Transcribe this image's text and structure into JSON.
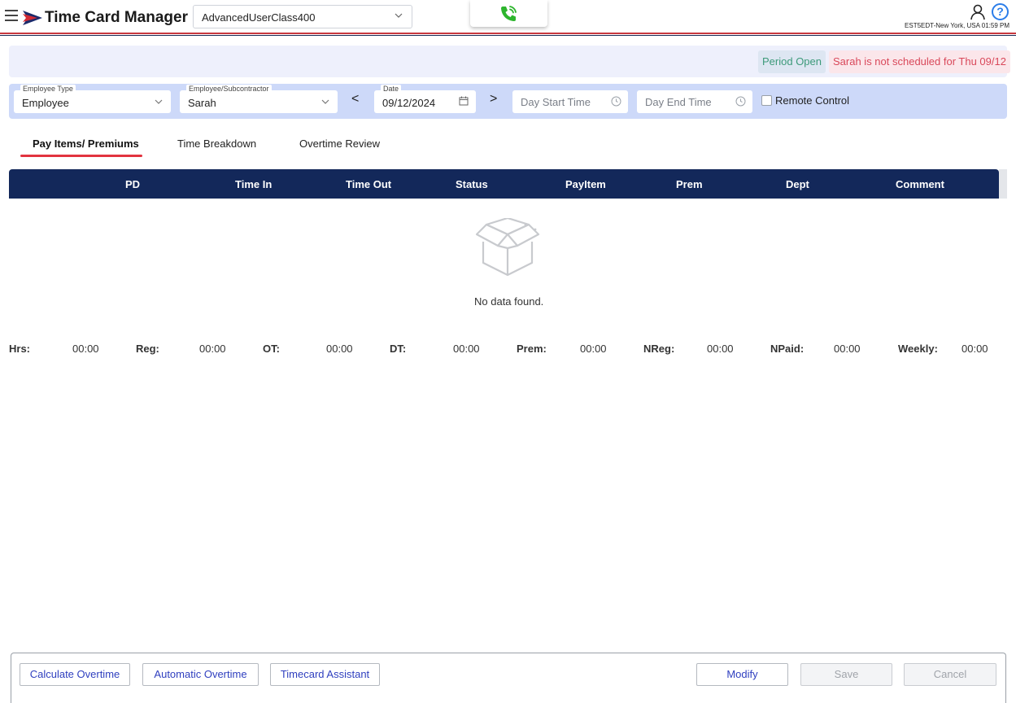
{
  "header": {
    "title": "Time Card Manager",
    "user_class": "AdvancedUserClass400",
    "timezone": "EST5EDT-New York, USA 01:59 PM",
    "help_glyph": "?"
  },
  "status": {
    "period": "Period Open",
    "schedule_notice": "Sarah is not scheduled for Thu 09/12"
  },
  "filters": {
    "employee_type_label": "Employee Type",
    "employee_type_value": "Employee",
    "employee_label": "Employee/Subcontractor",
    "employee_value": "Sarah",
    "date_label": "Date",
    "date_value": "09/12/2024",
    "prev_glyph": "<",
    "next_glyph": ">",
    "day_start_placeholder": "Day Start Time",
    "day_end_placeholder": "Day End Time",
    "remote_control_label": "Remote Control"
  },
  "tabs": [
    {
      "label": "Pay Items/ Premiums",
      "active": true
    },
    {
      "label": "Time Breakdown",
      "active": false
    },
    {
      "label": "Overtime Review",
      "active": false
    }
  ],
  "table": {
    "columns": [
      "PD",
      "Time In",
      "Time Out",
      "Status",
      "PayItem",
      "Prem",
      "Dept",
      "Comment"
    ],
    "empty_text": "No data found."
  },
  "totals": [
    {
      "label": "Hrs:",
      "value": "00:00"
    },
    {
      "label": "Reg:",
      "value": "00:00"
    },
    {
      "label": "OT:",
      "value": "00:00"
    },
    {
      "label": "DT:",
      "value": "00:00"
    },
    {
      "label": "Prem:",
      "value": "00:00"
    },
    {
      "label": "NReg:",
      "value": "00:00"
    },
    {
      "label": "NPaid:",
      "value": "00:00"
    },
    {
      "label": "Weekly:",
      "value": "00:00"
    }
  ],
  "footer": {
    "calculate_overtime": "Calculate Overtime",
    "automatic_overtime": "Automatic Overtime",
    "timecard_assistant": "Timecard Assistant",
    "modify": "Modify",
    "save": "Save",
    "cancel": "Cancel"
  },
  "colors": {
    "navy": "#13285a",
    "accent_red": "#e2333f",
    "filter_bg": "#cdd9f9",
    "phone_green": "#2db52d",
    "help_blue": "#2b7de9"
  },
  "icons": [
    "hamburger-icon",
    "logo-icon",
    "chevron-down-icon",
    "phone-icon",
    "user-icon",
    "help-icon",
    "calendar-icon",
    "clock-icon",
    "empty-box-icon"
  ]
}
